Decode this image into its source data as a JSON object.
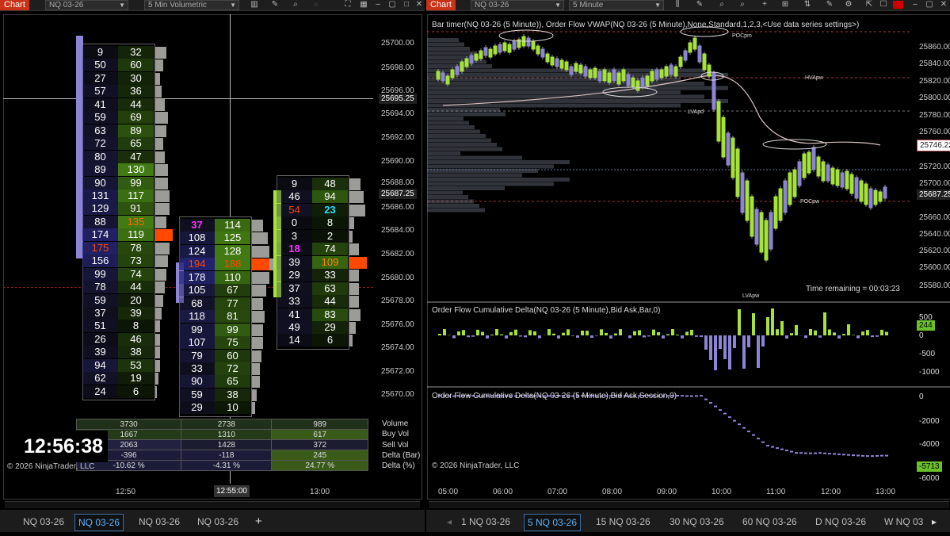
{
  "left_toolbar": {
    "chart_tag": "Chart",
    "instrument": "NQ 03-26",
    "interval": "5 Min Volumetric"
  },
  "right_toolbar": {
    "chart_tag": "Chart",
    "instrument": "NQ 03-26",
    "interval": "5 Minute"
  },
  "left_chart": {
    "price_labels": [
      "25700.00",
      "25698.00",
      "25696.00",
      "25694.00",
      "25692.00",
      "25690.00",
      "25688.00",
      "25686.00",
      "25684.00",
      "25682.00",
      "25680.00",
      "25678.00",
      "25676.00",
      "25674.00",
      "25672.00",
      "25670.00"
    ],
    "crosshair_price": "25695.25",
    "last_price": "25687.25",
    "time_labels": [
      "12:50",
      "12:55:00",
      "13:00"
    ],
    "clock": "12:56:38",
    "copyright": "© 2026 NinjaTrader, LLC",
    "bars": [
      {
        "rows": [
          [
            "9",
            "32"
          ],
          [
            "50",
            "60"
          ],
          [
            "27",
            "30"
          ],
          [
            "57",
            "36"
          ],
          [
            "41",
            "44"
          ],
          [
            "59",
            "69"
          ],
          [
            "63",
            "89"
          ],
          [
            "72",
            "65"
          ],
          [
            "80",
            "47"
          ],
          [
            "89",
            "130"
          ],
          [
            "90",
            "99"
          ],
          [
            "131",
            "117"
          ],
          [
            "129",
            "91"
          ],
          [
            "88",
            "135"
          ],
          [
            "174",
            "119"
          ],
          [
            "175",
            "78"
          ],
          [
            "156",
            "73"
          ],
          [
            "99",
            "74"
          ],
          [
            "78",
            "44"
          ],
          [
            "59",
            "20"
          ],
          [
            "37",
            "39"
          ],
          [
            "51",
            "8"
          ],
          [
            "26",
            "46"
          ],
          [
            "39",
            "38"
          ],
          [
            "94",
            "53"
          ],
          [
            "62",
            "19"
          ],
          [
            "24",
            "6"
          ]
        ]
      },
      {
        "rows": [
          [
            "37",
            "114"
          ],
          [
            "108",
            "125"
          ],
          [
            "124",
            "128"
          ],
          [
            "194",
            "188"
          ],
          [
            "178",
            "110"
          ],
          [
            "105",
            "67"
          ],
          [
            "68",
            "77"
          ],
          [
            "118",
            "81"
          ],
          [
            "99",
            "99"
          ],
          [
            "107",
            "75"
          ],
          [
            "79",
            "60"
          ],
          [
            "33",
            "72"
          ],
          [
            "90",
            "65"
          ],
          [
            "59",
            "38"
          ],
          [
            "29",
            "10"
          ]
        ]
      },
      {
        "rows": [
          [
            "9",
            "48"
          ],
          [
            "46",
            "94"
          ],
          [
            "54",
            "23"
          ],
          [
            "0",
            "8"
          ],
          [
            "3",
            "2"
          ],
          [
            "18",
            "74"
          ],
          [
            "39",
            "109"
          ],
          [
            "29",
            "33"
          ],
          [
            "37",
            "63"
          ],
          [
            "33",
            "44"
          ],
          [
            "41",
            "83"
          ],
          [
            "49",
            "29"
          ],
          [
            "14",
            "6"
          ]
        ]
      }
    ],
    "stats": {
      "labels": [
        "Volume",
        "Buy Vol",
        "Sell Vol",
        "Delta (Bar)",
        "Delta (%)"
      ],
      "columns": [
        [
          "3730",
          "1667",
          "2063",
          "-396",
          "-10.62 %"
        ],
        [
          "2738",
          "1310",
          "1428",
          "-118",
          "-4.31 %"
        ],
        [
          "989",
          "617",
          "372",
          "245",
          "24.77 %"
        ]
      ]
    }
  },
  "right_chart": {
    "title": "Bar timer(NQ 03-26 (5 Minute)), Order Flow VWAP(NQ 03-26 (5 Minute),None,Standard,1,2,3,<Use data series settings>)",
    "price_labels": [
      "25860.00",
      "25840.00",
      "25820.00",
      "25800.00",
      "25780.00",
      "25760.00",
      "25720.00",
      "25700.00",
      "25660.00",
      "25640.00",
      "25620.00",
      "25600.00",
      "25580.00"
    ],
    "vwap_price": "25746.22",
    "last_price": "25687.25",
    "level_labels": [
      "POCpm",
      "HVApw",
      "LVApd",
      "POCpw",
      "LVApw"
    ],
    "time_remaining": "Time remaining = 00:03:23",
    "delta_bar_title": "Order Flow Cumulative Delta(NQ 03-26 (5 Minute),Bid Ask,Bar,0)",
    "delta_bar_axis": [
      "500",
      "0",
      "-500",
      "-1000"
    ],
    "delta_bar_value": "244",
    "delta_session_title": "Order Flow Cumulative Delta(NQ 03-26 (5 Minute),Bid Ask,Session,0)",
    "delta_session_axis": [
      "0",
      "-2000",
      "-4000",
      "-6000"
    ],
    "delta_session_value": "-5713",
    "copyright": "© 2026 NinjaTrader, LLC",
    "time_labels": [
      "05:00",
      "06:00",
      "07:00",
      "08:00",
      "09:00",
      "10:00",
      "11:00",
      "12:00",
      "13:00"
    ]
  },
  "left_tabs": [
    "NQ 03-26",
    "NQ 03-26",
    "NQ 03-26",
    "NQ 03-26"
  ],
  "right_tabs": [
    "1 NQ 03-26",
    "5 NQ 03-26",
    "15 NQ 03-26",
    "30 NQ 03-26",
    "60 NQ 03-26",
    "D NQ 03-26",
    "W NQ 03"
  ],
  "colors": {
    "buy_green": "#3a5a1a",
    "sell_blue": "#1a1a3a",
    "candle_up": "#a6e23a",
    "candle_down": "#8c84d4",
    "poc": "#ff4800",
    "accent_tab": "#5ab4ff"
  }
}
